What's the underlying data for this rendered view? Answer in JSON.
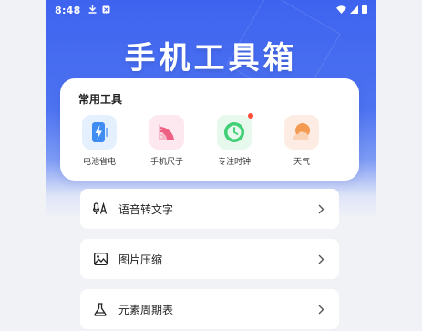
{
  "status_bar": {
    "time": "8:48"
  },
  "header": {
    "title": "手机工具箱"
  },
  "common_tools": {
    "title": "常用工具",
    "items": [
      {
        "label": "电池省电",
        "icon": "battery-bolt-icon",
        "bg": "#e4f0fd",
        "accent": "#3f8cf3"
      },
      {
        "label": "手机尺子",
        "icon": "ruler-protractor-icon",
        "bg": "#fde8ef",
        "accent": "#ee5f84"
      },
      {
        "label": "专注时钟",
        "icon": "clock-icon",
        "bg": "#e7f8ec",
        "accent": "#3fcf74",
        "badge": true
      },
      {
        "label": "天气",
        "icon": "weather-sun-cloud-icon",
        "bg": "#fdece4",
        "accent": "#f59a52"
      }
    ]
  },
  "list": [
    {
      "label": "语音转文字",
      "icon": "voice-text-icon"
    },
    {
      "label": "图片压缩",
      "icon": "image-icon"
    },
    {
      "label": "元素周期表",
      "icon": "flask-icon"
    }
  ],
  "colors": {
    "primary": "#3e63ef",
    "background": "#f1f2f6",
    "badge": "#ff4d3a"
  }
}
